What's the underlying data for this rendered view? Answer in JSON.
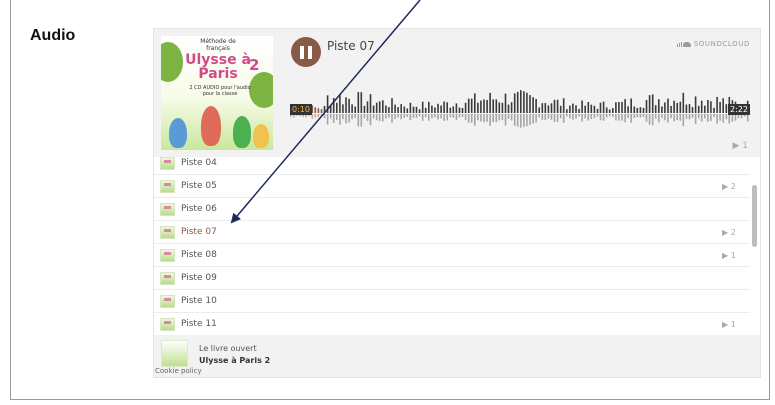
{
  "page": {
    "section_title": "Audio"
  },
  "player": {
    "artwork": {
      "title_line": "Méthode de français",
      "title": "Ulysse à Paris",
      "number": "2",
      "subtitle": "2 CD AUDIO pour l'audio pour la classe"
    },
    "current_track": "Piste 07",
    "brand": "SOUNDCLOUD",
    "time_elapsed": "0:10",
    "time_total": "2:22",
    "play_count": "1",
    "progress": 0.07
  },
  "tracks": [
    {
      "title": "Piste 04",
      "count": ""
    },
    {
      "title": "Piste 05",
      "count": "2"
    },
    {
      "title": "Piste 06",
      "count": ""
    },
    {
      "title": "Piste 07",
      "count": "2",
      "active": true
    },
    {
      "title": "Piste 08",
      "count": "1"
    },
    {
      "title": "Piste 09",
      "count": ""
    },
    {
      "title": "Piste 10",
      "count": ""
    },
    {
      "title": "Piste 11",
      "count": "1"
    }
  ],
  "footer": {
    "user": "Le livre ouvert",
    "playlist": "Ulysse à Paris 2",
    "cookie_policy": "Cookie policy"
  },
  "colors": {
    "accent": "#8a5a48",
    "arrow": "#1f2a5a"
  }
}
